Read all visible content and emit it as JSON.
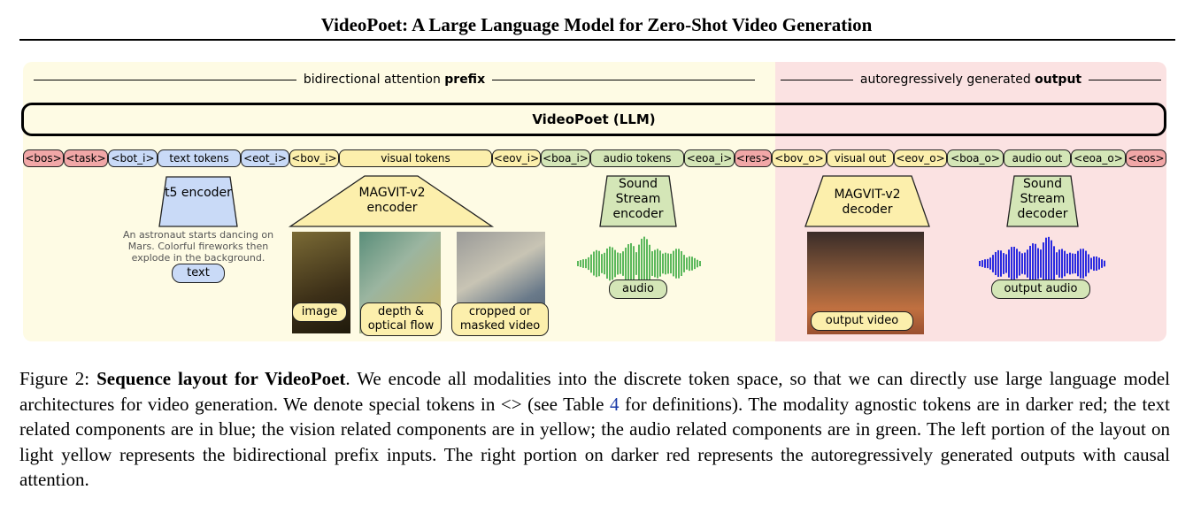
{
  "paper_title": "VideoPoet: A Large Language Model for Zero-Shot Video Generation",
  "figure": {
    "prefix_label": {
      "pre": "bidirectional attention ",
      "bold": "prefix"
    },
    "output_label": {
      "pre": "autoregressively generated ",
      "bold": "output"
    },
    "llm_label": "VideoPoet (LLM)",
    "tokens": [
      {
        "text": "<bos>",
        "color": "red"
      },
      {
        "text": "<task>",
        "color": "red"
      },
      {
        "text": "<bot_i>",
        "color": "blue"
      },
      {
        "text": "text tokens",
        "color": "blue"
      },
      {
        "text": "<eot_i>",
        "color": "blue"
      },
      {
        "text": "<bov_i>",
        "color": "yel"
      },
      {
        "text": "visual tokens",
        "color": "yel"
      },
      {
        "text": "<eov_i>",
        "color": "yel"
      },
      {
        "text": "<boa_i>",
        "color": "grn"
      },
      {
        "text": "audio tokens",
        "color": "grn"
      },
      {
        "text": "<eoa_i>",
        "color": "grn"
      },
      {
        "text": "<res>",
        "color": "red"
      },
      {
        "text": "<bov_o>",
        "color": "yel"
      },
      {
        "text": "visual out",
        "color": "yel"
      },
      {
        "text": "<eov_o>",
        "color": "yel"
      },
      {
        "text": "<boa_o>",
        "color": "grn"
      },
      {
        "text": "audio out",
        "color": "grn"
      },
      {
        "text": "<eoa_o>",
        "color": "grn"
      },
      {
        "text": "<eos>",
        "color": "red"
      }
    ],
    "colors": {
      "red": "#f1a7a7",
      "blue": "#c9daf7",
      "yel": "#fcefac",
      "grn": "#d4e6b7",
      "prefix_bg": "#fefbe4",
      "output_bg": "#fbe2e2",
      "audio_in": "#5cb85c",
      "audio_out": "#2a2ae0"
    },
    "t5_encoder": "t5 encoder",
    "magvit_encoder": "MAGVIT-v2 encoder",
    "sound_encoder": "Sound Stream encoder",
    "magvit_decoder": "MAGVIT-v2 decoder",
    "sound_decoder": "Sound Stream decoder",
    "prompt_text": "An astronaut starts dancing on Mars. Colorful fireworks then explode in the background.",
    "text_pill": "text",
    "image_pill": "image",
    "depth_pill": "depth & optical flow",
    "cropped_pill": "cropped or masked video",
    "audio_pill": "audio",
    "output_video_pill": "output video",
    "output_audio_pill": "output audio"
  },
  "caption": {
    "label": "Figure 2: ",
    "bold": "Sequence layout for VideoPoet",
    "part1": ". We encode all modalities into the discrete token space, so that we can directly use large language model architectures for video generation. We denote special tokens in <> (see Table ",
    "table_ref": "4",
    "part2": " for definitions). The modality agnostic tokens are in darker red; the text related components are in blue; the vision related components are in yellow; the audio related components are in green. The left portion of the layout on light yellow represents the bidirectional prefix inputs. The right portion on darker red represents the autoregressively generated outputs with causal attention."
  }
}
